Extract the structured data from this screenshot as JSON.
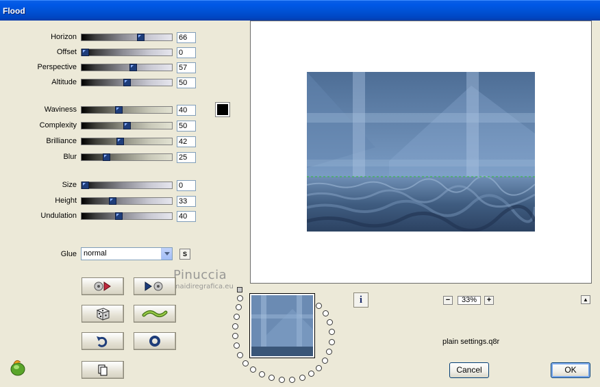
{
  "window": {
    "title": "Flood"
  },
  "sliders_group1": [
    {
      "label": "Horizon",
      "value": "66",
      "level": 0.66
    },
    {
      "label": "Offset",
      "value": "0",
      "level": 0.0
    },
    {
      "label": "Perspective",
      "value": "57",
      "level": 0.57
    },
    {
      "label": "Altitude",
      "value": "50",
      "level": 0.5
    }
  ],
  "sliders_group2": [
    {
      "label": "Waviness",
      "value": "40",
      "level": 0.4
    },
    {
      "label": "Complexity",
      "value": "50",
      "level": 0.5
    },
    {
      "label": "Brilliance",
      "value": "42",
      "level": 0.42
    },
    {
      "label": "Blur",
      "value": "25",
      "level": 0.25
    }
  ],
  "sliders_group3": [
    {
      "label": "Size",
      "value": "0",
      "level": 0.0
    },
    {
      "label": "Height",
      "value": "33",
      "level": 0.33
    },
    {
      "label": "Undulation",
      "value": "40",
      "level": 0.4
    }
  ],
  "color": {
    "swatch": "#000000"
  },
  "glue": {
    "label": "Glue",
    "value": "normal",
    "s_button": "S"
  },
  "watermark": {
    "text": "Pinuccia",
    "sub": "www.maidiregrafica.eu"
  },
  "zoom": {
    "value": "33%",
    "minus": "−",
    "plus": "+"
  },
  "info_icon": "i",
  "preset": {
    "name": "plain settings.q8r"
  },
  "buttons": {
    "cancel": "Cancel",
    "ok": "OK"
  },
  "icons": {
    "randomize-preset": "dice-icon",
    "reset": "undo-icon",
    "copy": "copy-icon",
    "app": "filter-forge-icon"
  }
}
